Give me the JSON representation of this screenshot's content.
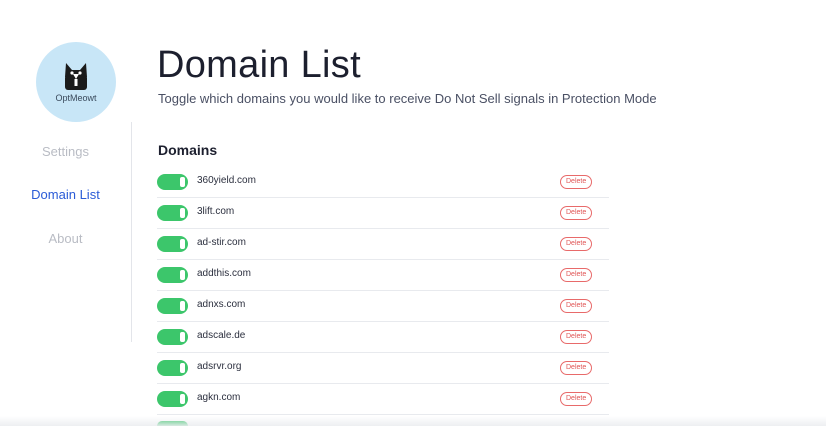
{
  "logo": {
    "text": "OptMeowt",
    "icon": "cat-icon"
  },
  "sidebar": {
    "items": [
      {
        "label": "Settings",
        "active": false
      },
      {
        "label": "Domain List",
        "active": true
      },
      {
        "label": "About",
        "active": false
      }
    ]
  },
  "main": {
    "title": "Domain List",
    "subtitle": "Toggle which domains you would like to receive Do Not Sell signals in Protection Mode",
    "section_heading": "Domains",
    "delete_label": "Delete",
    "domains": [
      {
        "name": "360yield.com",
        "enabled": true
      },
      {
        "name": "3lift.com",
        "enabled": true
      },
      {
        "name": "ad-stir.com",
        "enabled": true
      },
      {
        "name": "addthis.com",
        "enabled": true
      },
      {
        "name": "adnxs.com",
        "enabled": true
      },
      {
        "name": "adscale.de",
        "enabled": true
      },
      {
        "name": "adsrvr.org",
        "enabled": true
      },
      {
        "name": "agkn.com",
        "enabled": true
      }
    ]
  },
  "colors": {
    "accent": "#2a5bd7",
    "toggle_on": "#3cc66b",
    "delete": "#e05555",
    "logo_bg": "#c8e6f7"
  }
}
